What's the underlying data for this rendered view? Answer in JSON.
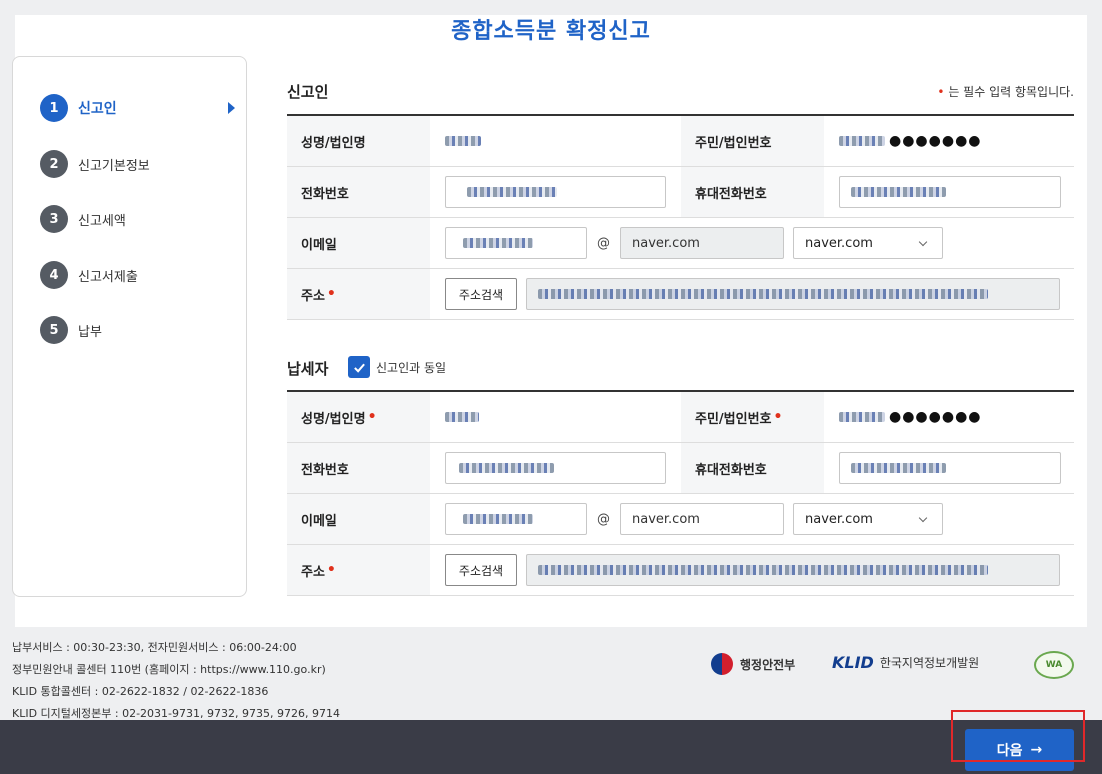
{
  "page": {
    "title": "종합소득분 확정신고"
  },
  "steps": [
    {
      "num": "1",
      "label": "신고인",
      "active": true
    },
    {
      "num": "2",
      "label": "신고기본정보"
    },
    {
      "num": "3",
      "label": "신고세액"
    },
    {
      "num": "4",
      "label": "신고서제출"
    },
    {
      "num": "5",
      "label": "납부"
    }
  ],
  "reporter": {
    "title": "신고인",
    "required_note": "는 필수 입력 항목입니다.",
    "required_mark": "•",
    "name_label": "성명/법인명",
    "rrn_label": "주민/법인번호",
    "rrn_mask": "●●●●●●●",
    "phone_label": "전화번호",
    "mobile_label": "휴대전화번호",
    "email_label": "이메일",
    "email_at": "@",
    "email_domain": "naver.com",
    "email_select": "naver.com",
    "address_label": "주소",
    "address_button": "주소검색"
  },
  "taxpayer": {
    "title": "납세자",
    "same_label": "신고인과 동일",
    "name_label": "성명/법인명",
    "rrn_label": "주민/법인번호",
    "rrn_mask": "●●●●●●●",
    "phone_label": "전화번호",
    "mobile_label": "휴대전화번호",
    "email_label": "이메일",
    "email_at": "@",
    "email_domain": "naver.com",
    "email_select": "naver.com",
    "address_label": "주소",
    "address_button": "주소검색"
  },
  "footer": {
    "lines": [
      "납부서비스 : 00:30-23:30, 전자민원서비스 : 06:00-24:00",
      "정부민원안내 콜센터 110번 (홈페이지 : https://www.110.go.kr)",
      "KLID 통합콜센터 : 02-2622-1832 / 02-2622-1836",
      "KLID 디지털세정본부 : 02-2031-9731, 9732, 9735, 9726, 9714"
    ],
    "logo_mois": "행정안전부",
    "logo_klid_mark": "KLID",
    "logo_klid_text": "한국지역정보개발원",
    "logo_wa": "WA"
  },
  "actions": {
    "next_label": "다음",
    "next_arrow": "→"
  }
}
